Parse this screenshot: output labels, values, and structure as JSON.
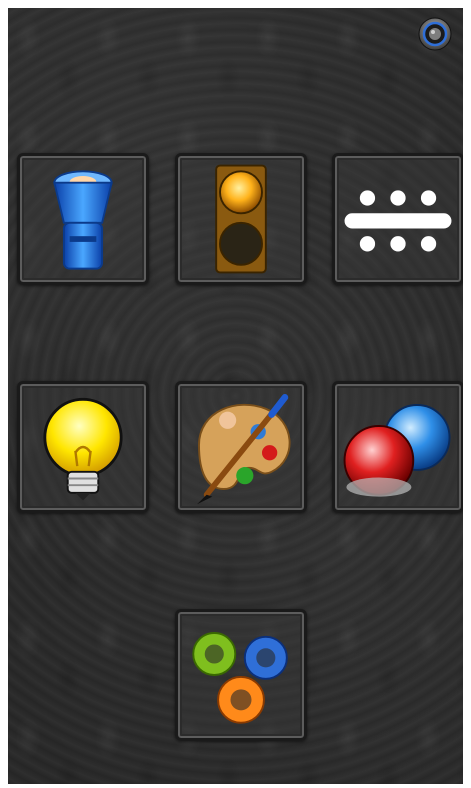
{
  "screen": {
    "background": "#2a2a2a",
    "tile_border": "#1a1a1a"
  },
  "top_bar": {
    "power_button": {
      "icon": "power-icon",
      "accent": "#2f6fd8"
    }
  },
  "grid": {
    "tiles": [
      {
        "id": "flashlight",
        "icon": "flashlight-icon",
        "accent": "#1e6fe0"
      },
      {
        "id": "traffic-light",
        "icon": "traffic-light-icon",
        "accent": "#f0a020"
      },
      {
        "id": "morse-code",
        "icon": "morse-code-icon",
        "accent": "#ffffff"
      },
      {
        "id": "light-bulb",
        "icon": "light-bulb-icon",
        "accent": "#ffe000"
      },
      {
        "id": "color-palette",
        "icon": "paint-palette-icon",
        "accent": "#d7a35a"
      },
      {
        "id": "police-lights",
        "icon": "police-lights-icon",
        "accent": "#d41a1a"
      },
      {
        "id": "settings",
        "icon": "gears-icon",
        "accent": "#7fbf1e"
      }
    ]
  }
}
